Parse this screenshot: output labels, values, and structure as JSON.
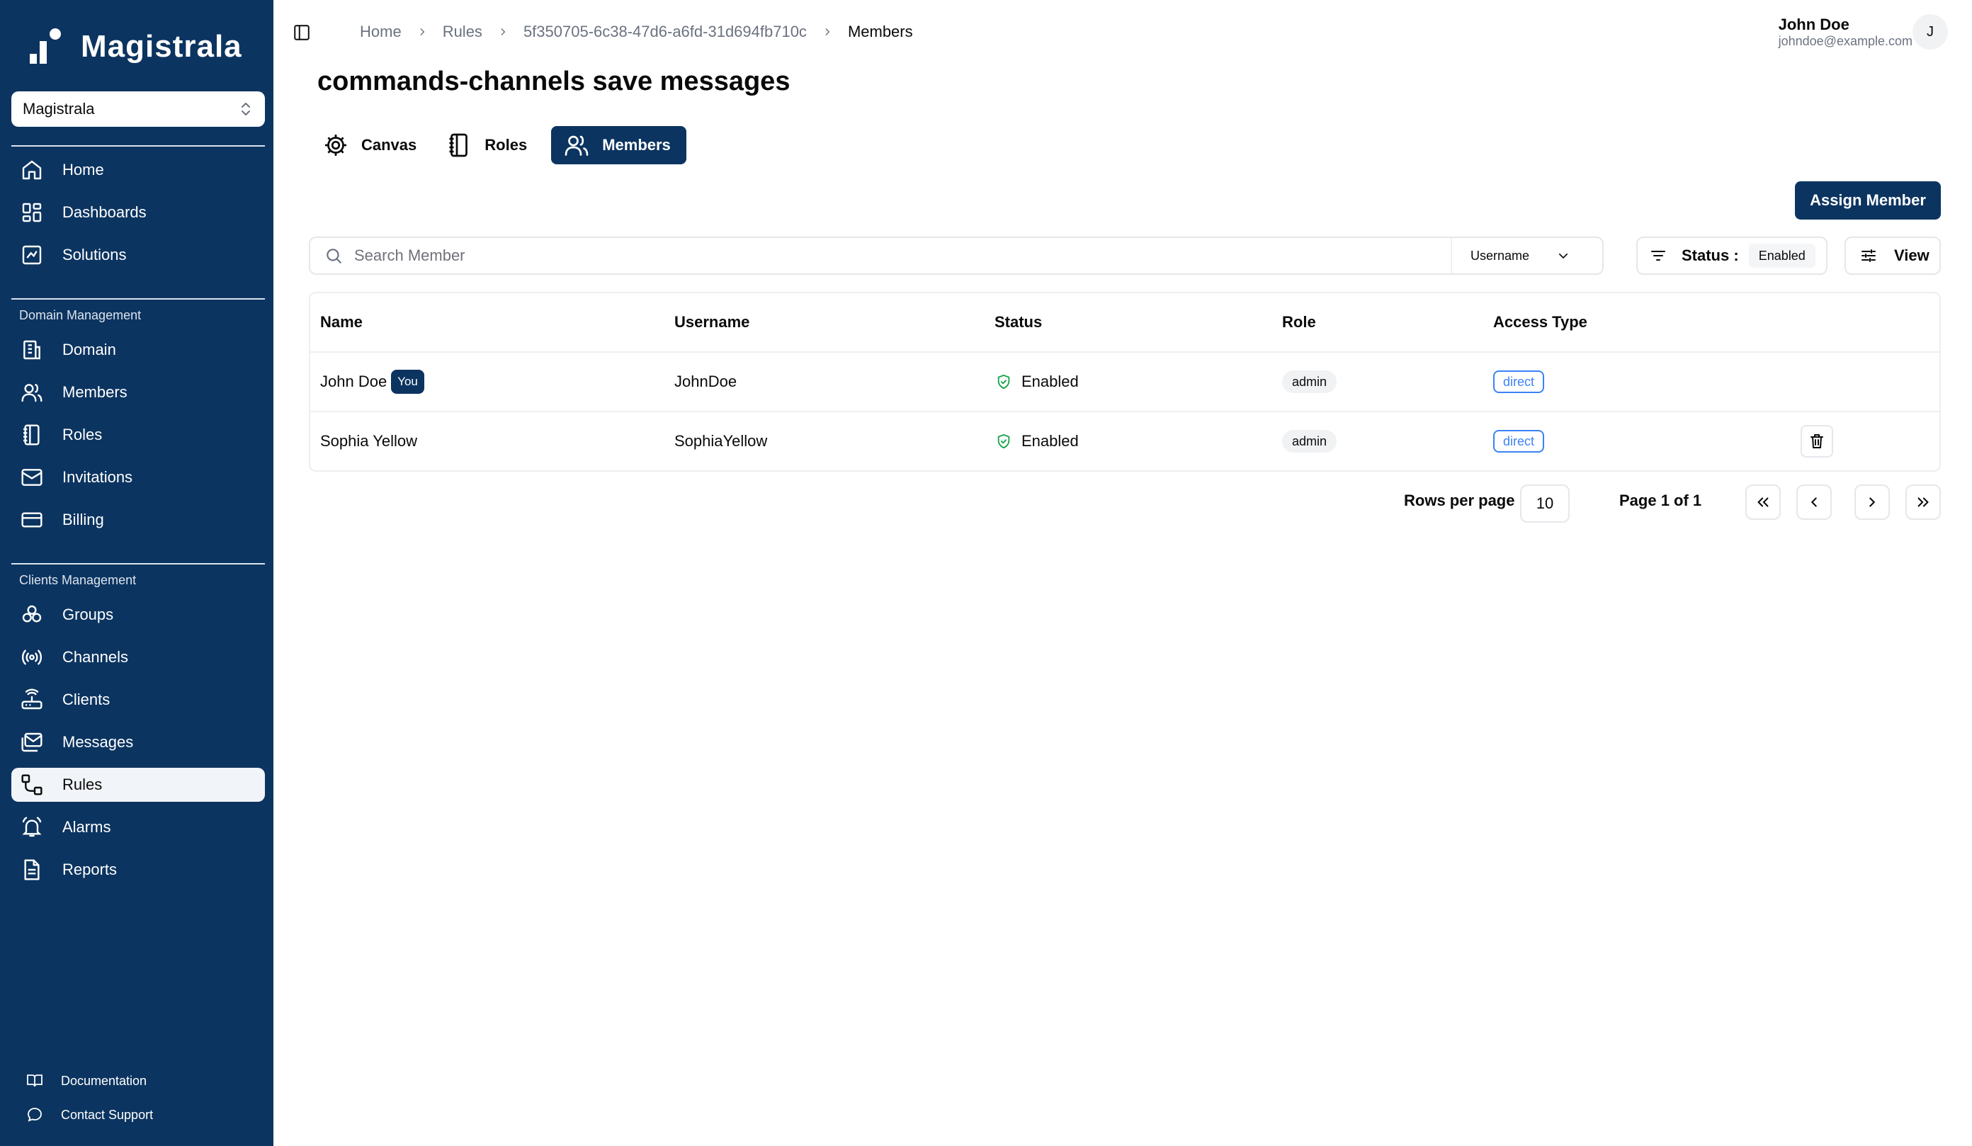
{
  "brand": {
    "name": "Magistrala"
  },
  "domain_selector": {
    "value": "Magistrala"
  },
  "sidebar": {
    "main_items": [
      {
        "label": "Home",
        "icon": "home-icon"
      },
      {
        "label": "Dashboards",
        "icon": "dashboards-icon"
      },
      {
        "label": "Solutions",
        "icon": "solutions-icon"
      }
    ],
    "domain_section": "Domain Management",
    "domain_items": [
      {
        "label": "Domain",
        "icon": "domain-icon"
      },
      {
        "label": "Members",
        "icon": "members-icon"
      },
      {
        "label": "Roles",
        "icon": "roles-icon"
      },
      {
        "label": "Invitations",
        "icon": "mail-icon"
      },
      {
        "label": "Billing",
        "icon": "card-icon"
      }
    ],
    "clients_section": "Clients Management",
    "clients_items": [
      {
        "label": "Groups",
        "icon": "groups-icon"
      },
      {
        "label": "Channels",
        "icon": "broadcast-icon"
      },
      {
        "label": "Clients",
        "icon": "router-icon"
      },
      {
        "label": "Messages",
        "icon": "messages-icon"
      },
      {
        "label": "Rules",
        "icon": "rules-icon",
        "active": true
      },
      {
        "label": "Alarms",
        "icon": "bell-icon"
      },
      {
        "label": "Reports",
        "icon": "report-icon"
      }
    ],
    "footer": [
      {
        "label": "Documentation",
        "icon": "book-icon"
      },
      {
        "label": "Contact Support",
        "icon": "chat-icon"
      }
    ]
  },
  "breadcrumb": [
    "Home",
    "Rules",
    "5f350705-6c38-47d6-a6fd-31d694fb710c",
    "Members"
  ],
  "user": {
    "name": "John Doe",
    "email": "johndoe@example.com",
    "initial": "J"
  },
  "page": {
    "title": "commands-channels save messages"
  },
  "tabs": [
    {
      "label": "Canvas",
      "icon": "gear-icon"
    },
    {
      "label": "Roles",
      "icon": "notebook-icon"
    },
    {
      "label": "Members",
      "icon": "users-icon",
      "active": true
    }
  ],
  "toolbar": {
    "assign_label": "Assign Member",
    "search_placeholder": "Search Member",
    "search_field": "Username",
    "status_label": "Status :",
    "status_value": "Enabled",
    "view_label": "View"
  },
  "table": {
    "columns": [
      "Name",
      "Username",
      "Status",
      "Role",
      "Access Type"
    ],
    "rows": [
      {
        "name": "John Doe",
        "you_badge": "You",
        "username": "JohnDoe",
        "status": "Enabled",
        "role": "admin",
        "access": "direct"
      },
      {
        "name": "Sophia Yellow",
        "username": "SophiaYellow",
        "status": "Enabled",
        "role": "admin",
        "access": "direct"
      }
    ]
  },
  "pagination": {
    "rows_label": "Rows per page",
    "rows_value": "10",
    "page_info": "Page 1 of 1"
  },
  "colors": {
    "primary": "#0c3460",
    "access_blue": "#3b82f6",
    "status_green": "#16a34a"
  }
}
